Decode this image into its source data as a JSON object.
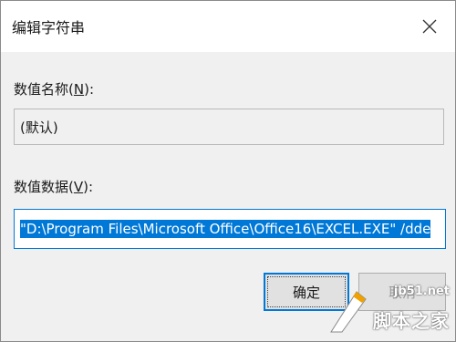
{
  "window": {
    "title": "编辑字符串",
    "close_glyph": "X"
  },
  "value_name": {
    "label": "数值名称(",
    "mnemonic": "N",
    "label_suffix": "):",
    "value": "(默认)"
  },
  "value_data": {
    "label": "数值数据(",
    "mnemonic": "V",
    "label_suffix": "):",
    "value": "\"D:\\Program Files\\Microsoft Office\\Office16\\EXCEL.EXE\" /dde"
  },
  "buttons": {
    "ok_label": "确定",
    "cancel_label": "取消"
  },
  "watermark": {
    "url": "jb51.net",
    "text": "脚本之家"
  },
  "colors": {
    "accent": "#0078d7",
    "background": "#f0f0f0"
  }
}
